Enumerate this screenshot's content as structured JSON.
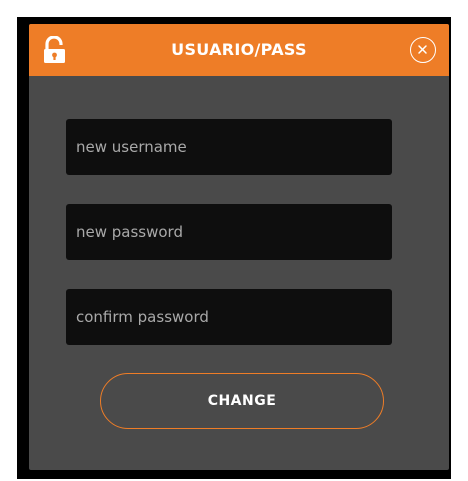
{
  "dialog": {
    "title": "USUARIO/PASS",
    "header_icon": "unlocked-padlock-icon",
    "close_icon": "close-circle-icon",
    "accent_color": "#ee7d27",
    "panel_color": "#4a4a4a",
    "field_color": "#0e0e0e"
  },
  "form": {
    "username": {
      "placeholder": "new username",
      "value": ""
    },
    "password": {
      "placeholder": "new password",
      "value": ""
    },
    "confirm": {
      "placeholder": "confirm password",
      "value": ""
    },
    "submit_label": "CHANGE"
  }
}
